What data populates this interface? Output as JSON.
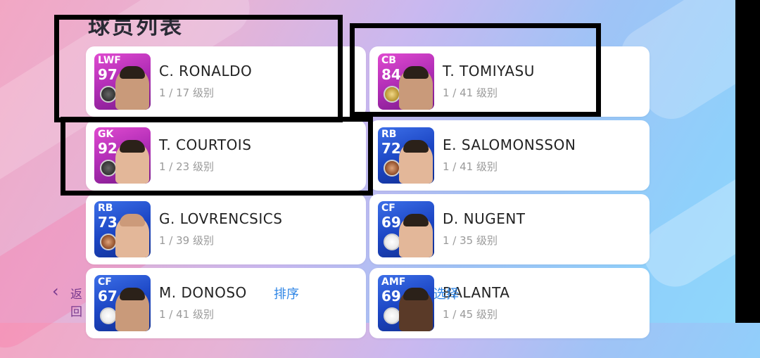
{
  "page": {
    "title": "球员列表"
  },
  "players": [
    {
      "position": "LWF",
      "rating": "97",
      "name": "C. RONALDO",
      "level": "1 / 17 级别",
      "card": "purple"
    },
    {
      "position": "CB",
      "rating": "84",
      "name": "T. TOMIYASU",
      "level": "1 / 41 级别",
      "card": "purple"
    },
    {
      "position": "GK",
      "rating": "92",
      "name": "T. COURTOIS",
      "level": "1 / 23 级别",
      "card": "purple"
    },
    {
      "position": "RB",
      "rating": "72",
      "name": "E. SALOMONSSON",
      "level": "1 / 41 级别",
      "card": "blue"
    },
    {
      "position": "RB",
      "rating": "73",
      "name": "G. LOVRENCSICS",
      "level": "1 / 39 级别",
      "card": "blue"
    },
    {
      "position": "CF",
      "rating": "69",
      "name": "D. NUGENT",
      "level": "1 / 35 级别",
      "card": "blue"
    },
    {
      "position": "CF",
      "rating": "67",
      "name": "M. DONOSO",
      "level": "1 / 41 级别",
      "card": "blue"
    },
    {
      "position": "AMF",
      "rating": "69",
      "name": "BALANTA",
      "level": "1 / 45 级别",
      "card": "blue"
    }
  ],
  "footer": {
    "back_label": "返回",
    "sort_label": "排序",
    "select_label": "选择"
  },
  "colors": {
    "purple_card": "#b42fb8",
    "blue_card": "#1c46c4",
    "link_blue": "#2f86e6",
    "back_purple": "#7a3a8f"
  }
}
